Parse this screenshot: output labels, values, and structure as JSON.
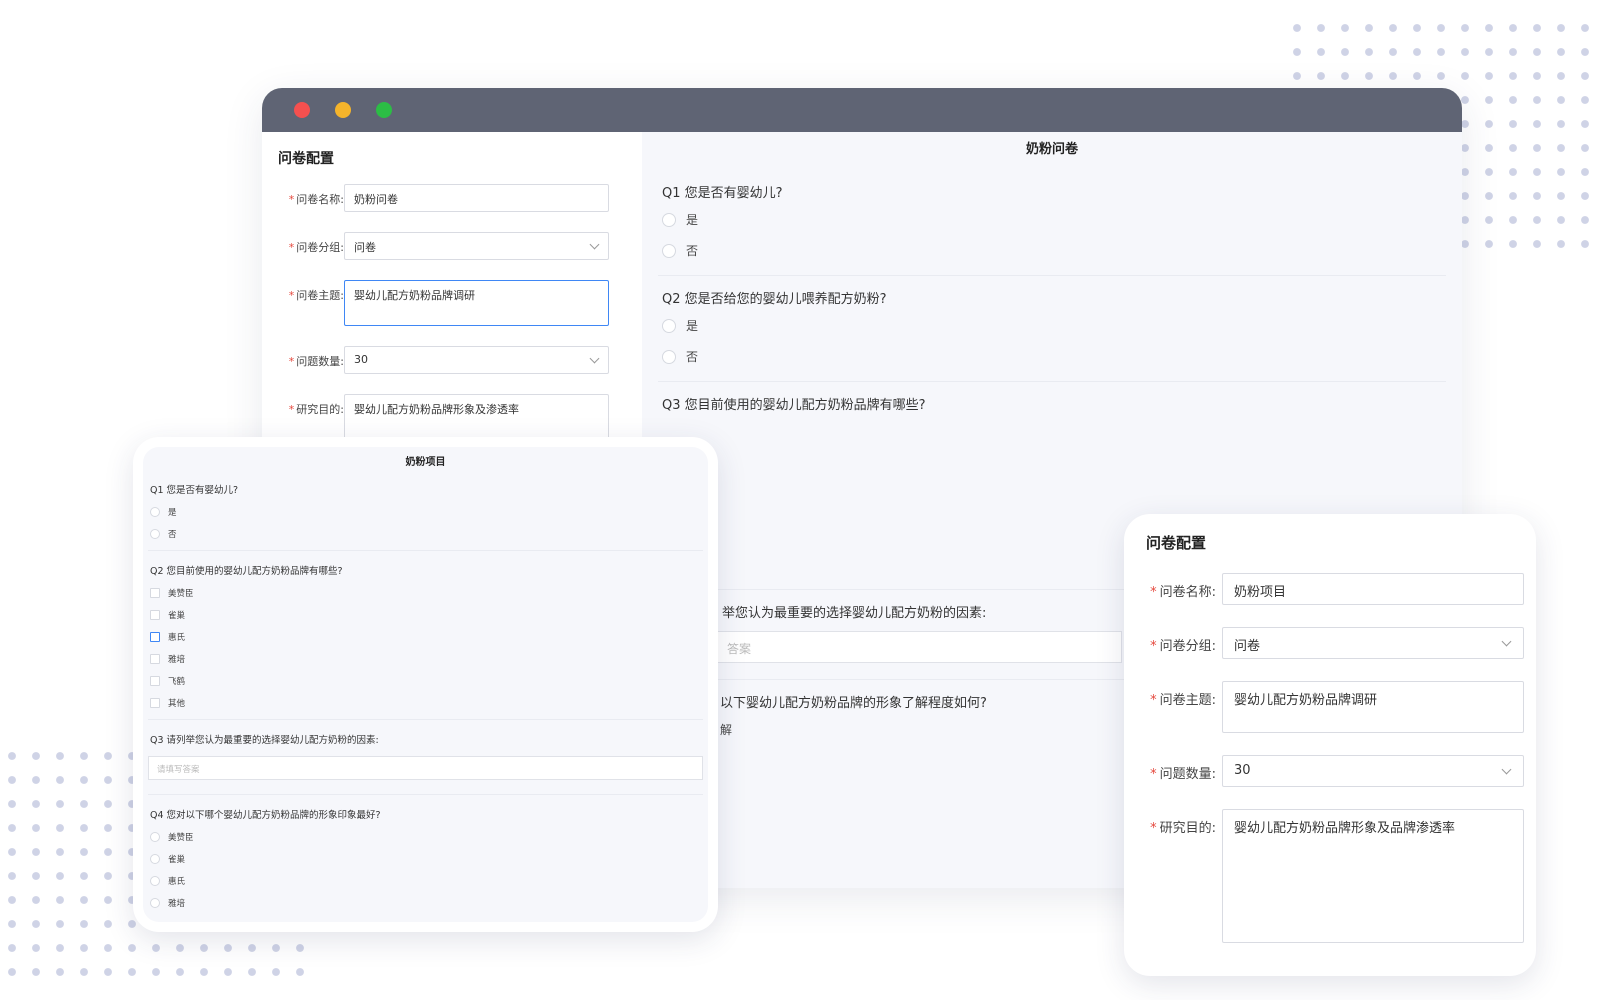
{
  "main_window": {
    "config": {
      "title": "问卷配置",
      "fields": [
        {
          "label": "问卷名称",
          "value": "奶粉问卷",
          "type": "text"
        },
        {
          "label": "问卷分组",
          "value": "问卷",
          "type": "select"
        },
        {
          "label": "问卷主题",
          "value": "婴幼儿配方奶粉品牌调研",
          "type": "textarea"
        },
        {
          "label": "问题数量",
          "value": "30",
          "type": "select"
        },
        {
          "label": "研究目的",
          "value": "婴幼儿配方奶粉品牌形象及渗透率",
          "type": "textarea"
        }
      ]
    },
    "preview": {
      "title": "奶粉问卷",
      "q1": {
        "text": "Q1 您是否有婴幼儿?",
        "options": [
          "是",
          "否"
        ]
      },
      "q2": {
        "text": "Q2 您是否给您的婴幼儿喂养配方奶粉?",
        "options": [
          "是",
          "否"
        ]
      },
      "q3": {
        "text": "Q3 您目前使用的婴幼儿配方奶粉品牌有哪些?"
      },
      "q4": {
        "text": "举您认为最重要的选择婴幼儿配方奶粉的因素:",
        "answer_placeholder": "答案"
      },
      "q5": {
        "text": "以下婴幼儿配方奶粉品牌的形象了解程度如何?",
        "option": "解"
      }
    }
  },
  "tablet": {
    "title": "奶粉项目",
    "q1": {
      "text": "Q1 您是否有婴幼儿?",
      "options": [
        "是",
        "否"
      ]
    },
    "q2": {
      "text": "Q2 您目前使用的婴幼儿配方奶粉品牌有哪些?",
      "options": [
        "美赞臣",
        "雀巢",
        "惠氏",
        "雅培",
        "飞鹤",
        "其他"
      ]
    },
    "q3": {
      "text": "Q3 请列举您认为最重要的选择婴幼儿配方奶粉的因素:",
      "placeholder": "请填写答案"
    },
    "q4": {
      "text": "Q4 您对以下哪个婴幼儿配方奶粉品牌的形象印象最好?",
      "options": [
        "美赞臣",
        "雀巢",
        "惠氏",
        "雅培"
      ]
    }
  },
  "right_card": {
    "title": "问卷配置",
    "fields": [
      {
        "label": "问卷名称",
        "value": "奶粉项目"
      },
      {
        "label": "问卷分组",
        "value": "问卷"
      },
      {
        "label": "问卷主题",
        "value": "婴幼儿配方奶粉品牌调研"
      },
      {
        "label": "问题数量",
        "value": "30"
      },
      {
        "label": "研究目的",
        "value": "婴幼儿配方奶粉品牌形象及品牌渗透率"
      }
    ]
  },
  "colors": {
    "titlebar": "#5f6474",
    "required": "#e5483d",
    "focus": "#3f87f5",
    "preview_bg": "#f6f7fb"
  }
}
